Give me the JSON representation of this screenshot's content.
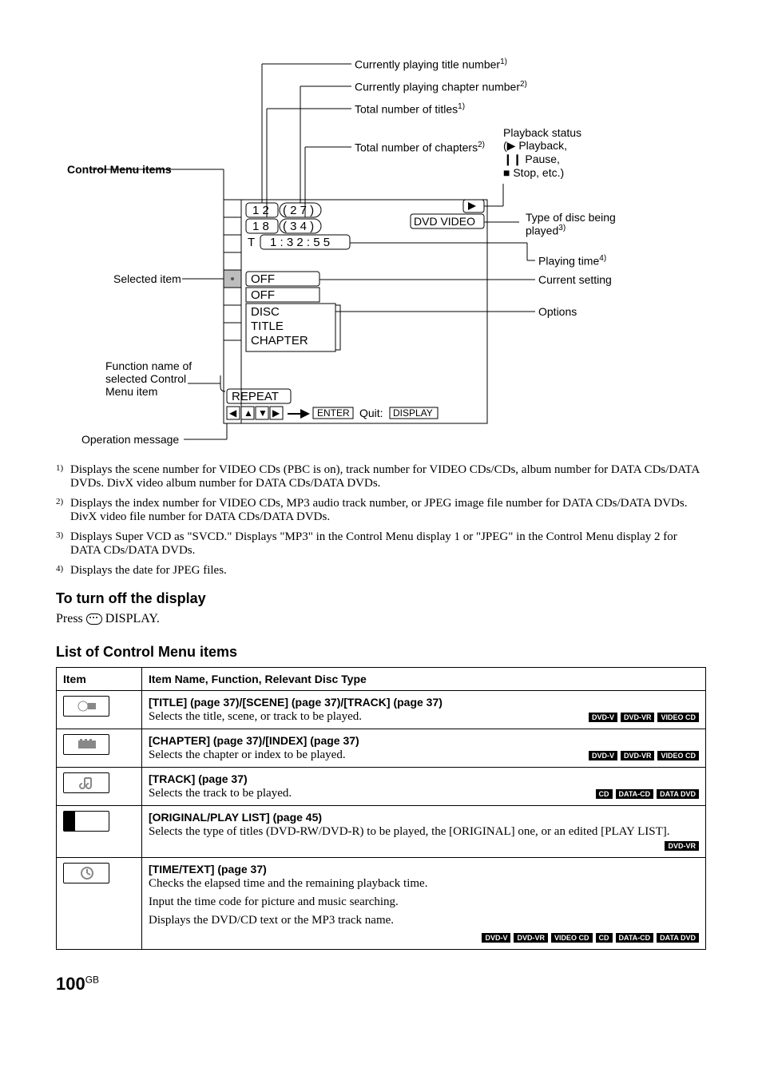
{
  "diagram": {
    "control_menu_items": "Control Menu items",
    "label_title_num": "Currently playing title number",
    "label_chapter_num": "Currently playing chapter number",
    "label_total_titles": "Total number of titles",
    "label_total_chapters": "Total number of chapters",
    "playback_status_head": "Playback status",
    "playback_line1": "(▶ Playback,",
    "playback_line2": "❙❙ Pause,",
    "playback_line3": "■ Stop, etc.)",
    "type_of_disc": "Type of disc being played",
    "playing_time": "Playing time",
    "current_setting": "Current setting",
    "options": "Options",
    "selected_item": "Selected item",
    "function_name_l1": "Function name of",
    "function_name_l2": "selected Control",
    "function_name_l3": "Menu item",
    "operation_message": "Operation message",
    "osd": {
      "title_cur": "1 2",
      "title_tot": "( 2 7 )",
      "chap_cur": "1 8",
      "chap_tot": "( 3 4 )",
      "time_letter": "T",
      "time": "1 : 3 2 : 5 5",
      "disc_type": "DVD VIDEO",
      "sel_off1": "OFF",
      "sel_off2": "OFF",
      "opt_disc": "DISC",
      "opt_title": "TITLE",
      "opt_chapter": "CHAPTER",
      "repeat": "REPEAT",
      "enter": "ENTER",
      "quit": "Quit:",
      "display": "DISPLAY"
    }
  },
  "footnotes": {
    "f1": "Displays the scene number for VIDEO CDs (PBC is on), track number for VIDEO CDs/CDs, album number for DATA CDs/DATA DVDs. DivX video album number for DATA CDs/DATA DVDs.",
    "f2": "Displays the index number for VIDEO CDs, MP3 audio track number, or JPEG image file number for DATA CDs/DATA DVDs. DivX video file number for DATA CDs/DATA DVDs.",
    "f3": "Displays Super VCD as \"SVCD.\" Displays \"MP3\" in the Control Menu display 1 or \"JPEG\" in the Control Menu display 2 for DATA CDs/DATA DVDs.",
    "f4": "Displays the date for JPEG files."
  },
  "sections": {
    "turn_off_h": "To turn off the display",
    "turn_off_body_pre": "Press ",
    "turn_off_body_post": " DISPLAY.",
    "list_h": "List of Control Menu items"
  },
  "table": {
    "header_item": "Item",
    "header_desc": "Item Name, Function, Relevant Disc Type",
    "rows": [
      {
        "name": "[TITLE] (page 37)/[SCENE] (page 37)/[TRACK] (page 37)",
        "desc": "Selects the title, scene, or track to be played.",
        "badges": [
          "DVD-V",
          "DVD-VR",
          "VIDEO CD"
        ]
      },
      {
        "name": "[CHAPTER] (page 37)/[INDEX] (page 37)",
        "desc": "Selects the chapter or index to be played.",
        "badges": [
          "DVD-V",
          "DVD-VR",
          "VIDEO CD"
        ]
      },
      {
        "name": "[TRACK] (page 37)",
        "desc": "Selects the track to be played.",
        "badges": [
          "CD",
          "DATA-CD",
          "DATA DVD"
        ]
      },
      {
        "name": "[ORIGINAL/PLAY LIST] (page 45)",
        "desc": "Selects the type of titles (DVD-RW/DVD-R) to be played, the [ORIGINAL] one, or an edited [PLAY LIST].",
        "badges": [
          "DVD-VR"
        ]
      },
      {
        "name": "[TIME/TEXT] (page 37)",
        "desc_lines": [
          "Checks the elapsed time and the remaining playback time.",
          "Input the time code for picture and music searching.",
          "Displays the DVD/CD text or the MP3 track name."
        ],
        "badges": [
          "DVD-V",
          "DVD-VR",
          "VIDEO CD",
          "CD",
          "DATA-CD",
          "DATA DVD"
        ]
      }
    ]
  },
  "page_number": "100",
  "page_suffix": "GB"
}
